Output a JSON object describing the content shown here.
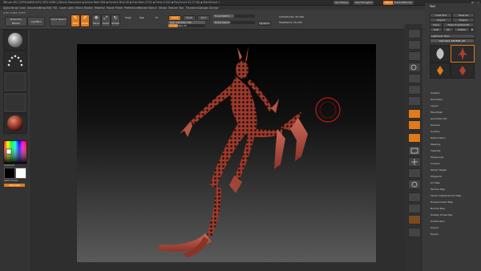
{
  "titlebar": {
    "app_title": "ZBrush 4R7  [0FFB-D6EB-5FF2-5FF2-D3BC]  ZBrush Document  ▪ Active Mem 964 ▪ Scratch Disk 46 ▪ Free Mem 2731 ▪ Timer 0.042 ▪ PolyCount 55.37 Mp ▪ MeshCount 1",
    "quicksave": "QuickSave",
    "see_through": "See-through 0",
    "menus_btn": "Menus",
    "script_btn": "DefaultZScript"
  },
  "coords": "0.54, 0.443, 0.673",
  "menubar": [
    "Alpha",
    "Brush",
    "Color",
    "Document",
    "Draw",
    "Edit",
    "File",
    "Layer",
    "Light",
    "Macro",
    "Marker",
    "Material",
    "Movie",
    "Picker",
    "Preferences",
    "Render",
    "Stencil",
    "Stroke",
    "Texture",
    "Tool",
    "Transform",
    "Zplugin",
    "Zscript"
  ],
  "toolbar": {
    "projection_master": "Projection Master",
    "lightbox": "LightBox",
    "quick_sketch": "Quick Sketch",
    "edit": "Edit",
    "draw": "Draw",
    "move": "Move",
    "scale": "Scale",
    "rotate": "Rotate",
    "mrgb": "Mrgb",
    "rgb": "Rgb",
    "m": "M",
    "zadd": "Zadd",
    "zsub": "Zsub",
    "zcut": "Zcut",
    "focal_shift": "Focal Shift 0",
    "draw_size": "Draw Size 64",
    "dynamic": "Dynamic",
    "rgb_intensity": "Rgb Intensity 100",
    "z_intensity": "Z Intensity 25",
    "active_points": "ActivePoints: 55,156",
    "total_points": "TotalPoints: 55,156"
  },
  "left": {
    "gradient_label": "Gradient",
    "switch_color": "SwitchColor",
    "alternate": "Alternate"
  },
  "palette": {
    "title": "Tool",
    "load_tool": "Load Tool",
    "save_as": "Save As",
    "import": "Import",
    "export": "Export",
    "clone": "Clone",
    "make_polymesh": "Make PolyMesh3D",
    "goz": "GoZ",
    "all": "All",
    "visible": "Visible",
    "r": "R",
    "lightbox_tools": "Lightbox▸ Tools",
    "current_tool": "Mermaid_SPHERE_48",
    "thumbs": [
      "SimpleBrush",
      "Mermaid_SPHERE",
      "Cylinder3D",
      "PolyMesh3D"
    ],
    "sections": [
      "Subtool",
      "Geometry",
      "Layers",
      "FiberMesh",
      "Geometry HD",
      "Preview",
      "Surface",
      "Deformation",
      "Masking",
      "Visibility",
      "Polygroups",
      "Contact",
      "Morph Target",
      "Polypaint",
      "UV Map",
      "Texture Map",
      "Vector Displacement Map",
      "Displacement Map",
      "Normal Map",
      "Display Properties",
      "Unified Skin",
      "Import",
      "Export"
    ]
  },
  "colors": {
    "accent": "#e07a1a",
    "model": "#9a3a2c",
    "cursor": "#c01818"
  },
  "icons": [
    "sphere-brush-icon",
    "dots-stroke-icon",
    "alpha-icon",
    "texture-icon",
    "material-sphere-icon",
    "color-picker-icon",
    "rotate-icon",
    "move-icon",
    "zoom-icon",
    "frame-icon"
  ]
}
